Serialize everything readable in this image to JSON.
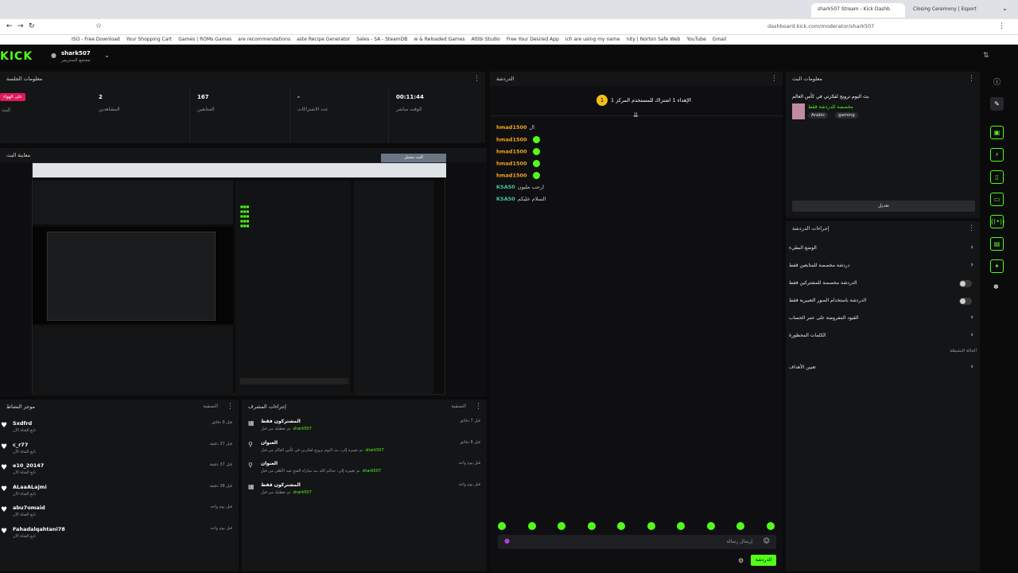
{
  "browser": {
    "tabs": [
      "shark507 Stream - Kick Dashb",
      "Closing Ceremony | Esport"
    ],
    "address": "dashboard.kick.com/moderator/shark507",
    "bookmarks": [
      "ISO - Free Download",
      "Your Shopping Cart",
      "Games | ROMs Games",
      "are recommendations",
      "aste Recipe Generator",
      "Sales - SA - SteamDB",
      "w & Reloaded Games",
      "Altibi Studio",
      "Free Your Desired App",
      "ich are using my name",
      "nity | Norton Safe Web",
      "YouTube",
      "Gmail"
    ]
  },
  "header": {
    "logo": "KICK",
    "channel_name": "shark507",
    "channel_sub": "مجتمع الستريمر"
  },
  "session": {
    "title": "معلومات الجلسة",
    "live_badge": "على الهواء",
    "live_label": "البث",
    "stats": [
      {
        "value": "2",
        "label": "المشاهدين"
      },
      {
        "value": "167",
        "label": "المتابعين"
      },
      {
        "value": "-",
        "label": "عدد الاشتراكات"
      },
      {
        "value": "00:11:44",
        "label": "الوقت مباشر"
      }
    ]
  },
  "preview": {
    "title": "معاينة البث",
    "overlay": "البث محمل"
  },
  "chat": {
    "title": "الدردشة",
    "pinned": "الإهداء 1 اشتراك للمستخدم المركز 1",
    "messages": [
      {
        "user": "hmad1500",
        "text": "ال"
      },
      {
        "user": "hmad1500",
        "text": ""
      },
      {
        "user": "hmad1500",
        "text": ""
      },
      {
        "user": "hmad1500",
        "text": ""
      },
      {
        "user": "hmad1500",
        "text": ""
      },
      {
        "user": "KSA50",
        "text": "ارحب مليون"
      },
      {
        "user": "KSA50",
        "text": "السلام عليكم"
      }
    ],
    "input_placeholder": "إرسال رسالة",
    "send_label": "الدردشة"
  },
  "stream_info": {
    "title": "معلومات البث",
    "stream_title": "بث اليوم ترويج لفكرتي في كأس العالم",
    "category": "مخصصة للدردشة فقط",
    "tags": [
      "Arabic",
      "gaming"
    ],
    "edit_label": "تعديل"
  },
  "quick_actions": {
    "title": "إجراءات الدردشة",
    "items": [
      {
        "label": "الوضع البطيء",
        "type": "chevron"
      },
      {
        "label": "دردشة مخصصة للمتابعين فقط",
        "type": "chevron"
      },
      {
        "label": "الدردشة مخصصة للمشتركين فقط",
        "type": "toggle"
      },
      {
        "label": "الدردشة باستخدام الصور التعبيرية فقط",
        "type": "toggle"
      },
      {
        "label": "القيود المفروضة على عمر الحساب",
        "type": "chevron"
      },
      {
        "label": "الكلمات المحظورة",
        "type": "chevron"
      }
    ],
    "section_label": "الحالة النشيطة",
    "goals_label": "تعيين الأهداف"
  },
  "activity": {
    "title": "موجز النشاط",
    "filter": "التصفية",
    "items": [
      {
        "user": "Sxdfrd",
        "sub": "تابع القناة الآن",
        "time": "قبل 9 دقائق"
      },
      {
        "user": "c_r77",
        "sub": "تابع القناة الآن",
        "time": "قبل 37 دقيقة"
      },
      {
        "user": "e10_20147",
        "sub": "تابع القناة الآن",
        "time": "قبل 37 دقيقة"
      },
      {
        "user": "ALaaALajmi",
        "sub": "تابع القناة الآن",
        "time": "قبل 38 دقيقة"
      },
      {
        "user": "abu7omaid",
        "sub": "تابع القناة الآن",
        "time": "قبل يوم واحد"
      },
      {
        "user": "Fahadalqahtani78",
        "sub": "تابع القناة الآن",
        "time": "قبل يوم واحد"
      }
    ]
  },
  "mod_actions": {
    "title": "إجراءات المشرف",
    "filter": "التصفية",
    "items": [
      {
        "title": "المشتركون فقط",
        "detail": "تم تعطيله من قبل",
        "user": "shark507",
        "time": "قبل 7 دقائق"
      },
      {
        "title": "العنوان",
        "detail": "تم تغييره إلى: بث اليوم ترويج لفكرتي في كأس العالم من قبل",
        "user": "shark507",
        "time": "قبل 8 دقائق"
      },
      {
        "title": "العنوان",
        "detail": "تم تغييره إلى: حياكم الله بث مباراة الفتح ضد الأهلي من قبل",
        "user": "shark507",
        "time": "قبل يوم واحد"
      },
      {
        "title": "المشتركون فقط",
        "detail": "تم تعطيله من قبل",
        "user": "shark507",
        "time": "قبل يوم واحد"
      }
    ]
  },
  "colors": {
    "accent": "#53fc18",
    "panel": "#141517",
    "bg": "#0b0b0c",
    "live": "#e1195a"
  }
}
